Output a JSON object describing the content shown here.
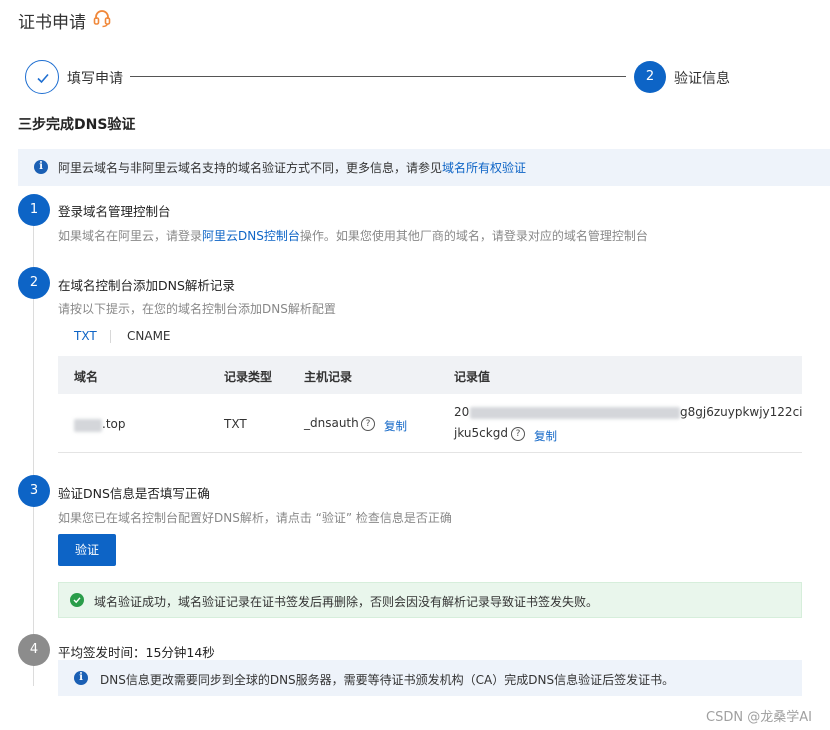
{
  "header": {
    "title": "证书申请",
    "support_icon": "headset-icon"
  },
  "stepper": {
    "steps": [
      {
        "label": "填写申请",
        "state": "done",
        "icon": "check-icon"
      },
      {
        "label": "验证信息",
        "state": "active",
        "number": "2"
      }
    ]
  },
  "section_title": "三步完成DNS验证",
  "notice": {
    "text": "阿里云域名与非阿里云域名支持的域名验证方式不同，更多信息，请参见",
    "link": "域名所有权验证"
  },
  "items": [
    {
      "number": "1",
      "title": "登录域名管理控制台",
      "desc_before": "如果域名在阿里云，请登录",
      "desc_link": "阿里云DNS控制台",
      "desc_after": "操作。如果您使用其他厂商的域名，请登录对应的域名管理控制台"
    },
    {
      "number": "2",
      "title": "在域名控制台添加DNS解析记录",
      "desc": "请按以下提示，在您的域名控制台添加DNS解析配置"
    },
    {
      "number": "3",
      "title": "验证DNS信息是否填写正确",
      "desc": "如果您已在域名控制台配置好DNS解析，请点击 “验证” 检查信息是否正确"
    },
    {
      "number": "4",
      "title": "平均签发时间：15分钟14秒"
    }
  ],
  "tabs": [
    {
      "label": "TXT",
      "active": true
    },
    {
      "label": "CNAME",
      "active": false
    }
  ],
  "table": {
    "headers": [
      "域名",
      "记录类型",
      "主机记录",
      "记录值"
    ],
    "row": {
      "domain_suffix": ".top",
      "record_type": "TXT",
      "host": "_dnsauth",
      "value_line1_prefix": "20",
      "value_line1_suffix": "g8gj6zuypkwjy122ci",
      "value_line2": "jku5ckgd",
      "copy_label": "复制"
    }
  },
  "verify_button": "验证",
  "success_message": "域名验证成功，域名验证记录在证书签发后再删除，否则会因没有解析记录导致证书签发失败。",
  "issue_notice": "DNS信息更改需要同步到全球的DNS服务器，需要等待证书颁发机构（CA）完成DNS信息验证后签发证书。",
  "watermark": "CSDN @龙桑学AI",
  "colors": {
    "primary": "#0d64c6",
    "success": "#2a9d4a",
    "info_bg": "#eef3fa",
    "success_bg": "#e9f6ec"
  }
}
